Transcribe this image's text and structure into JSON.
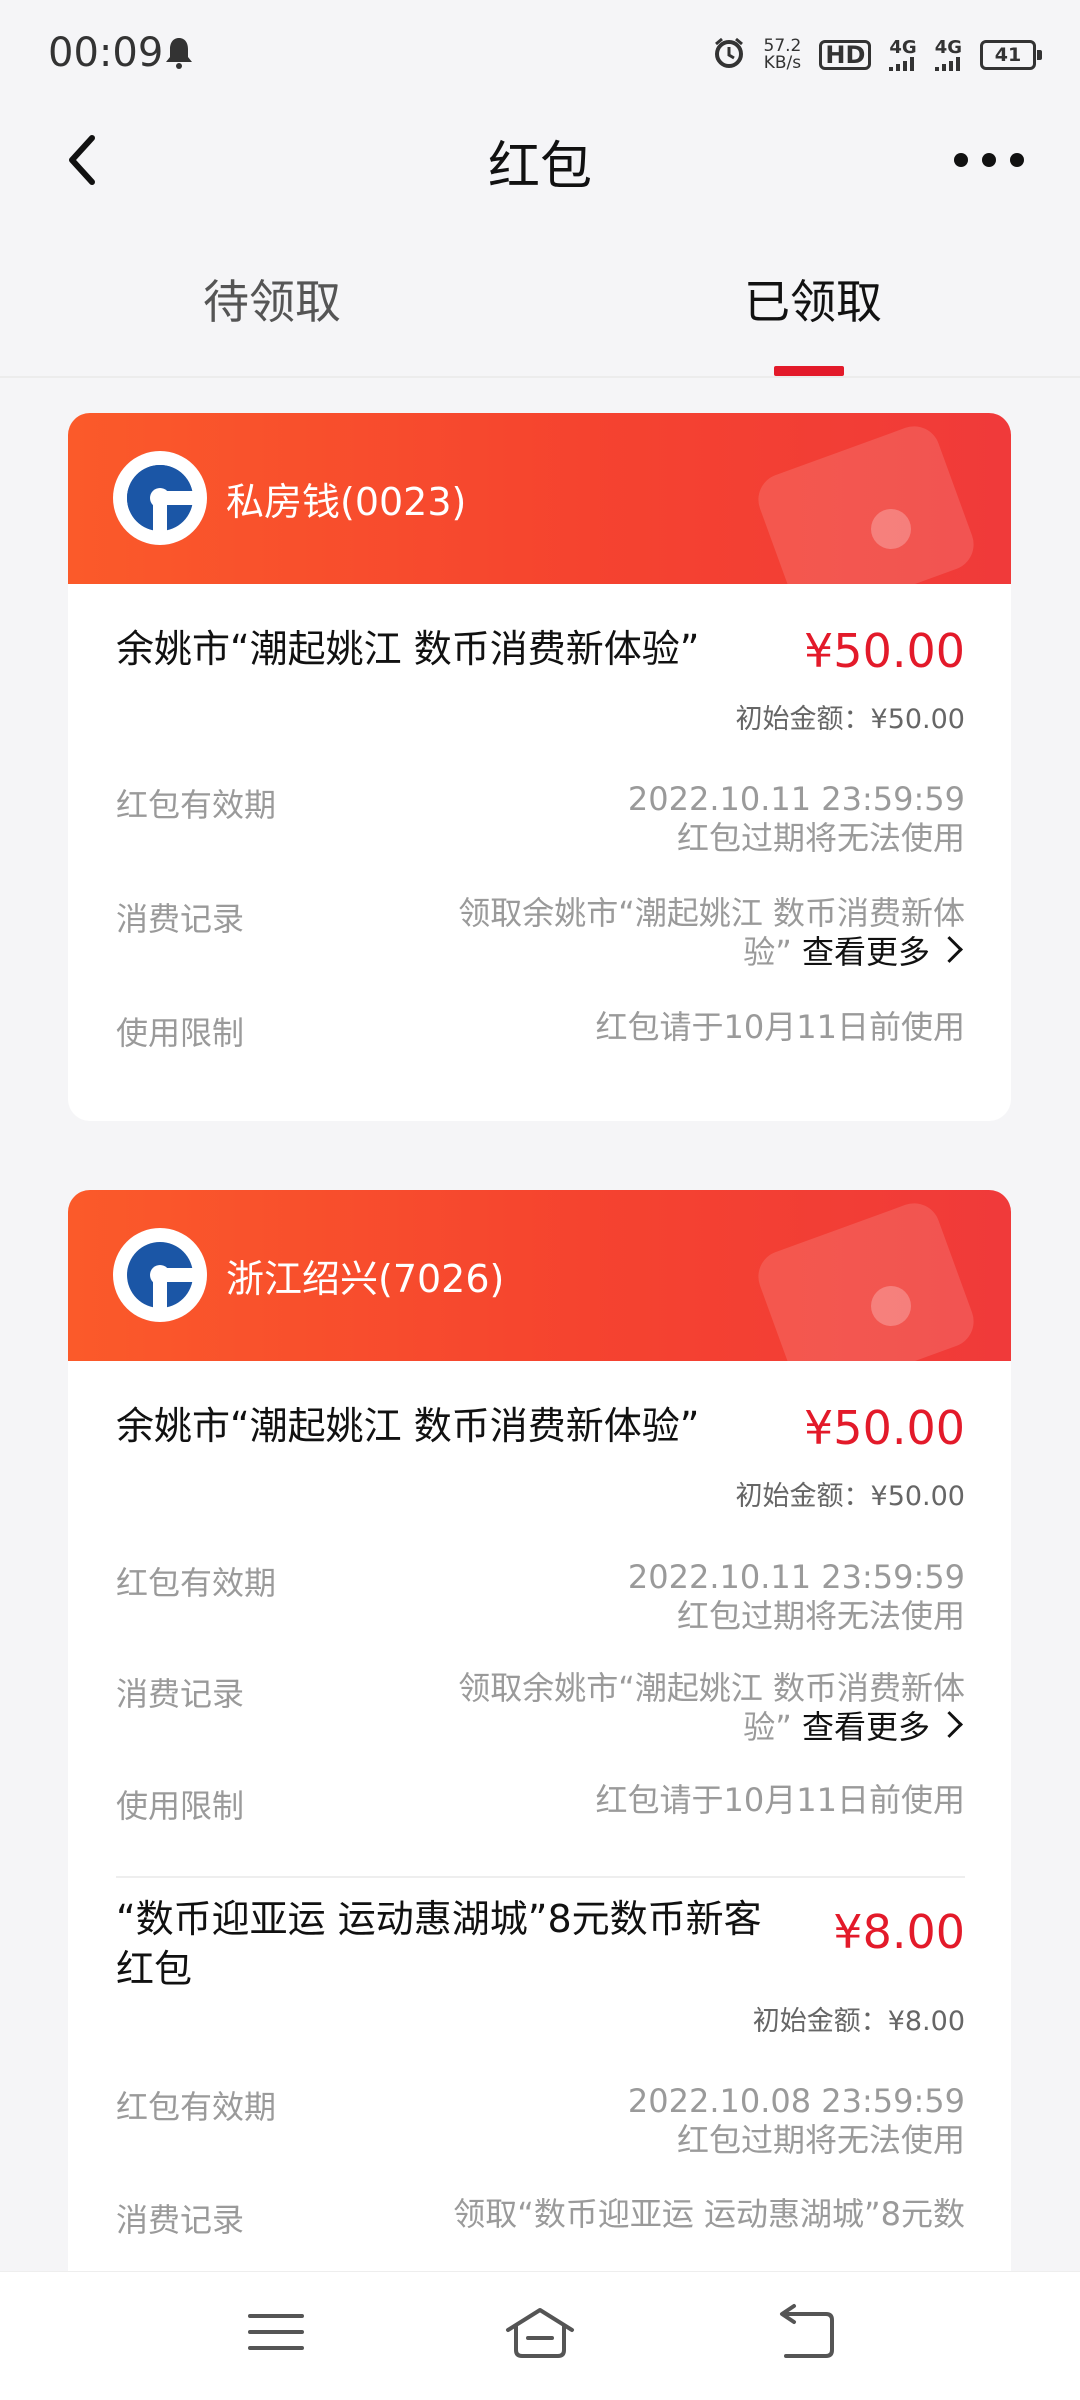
{
  "status_bar": {
    "time": "00:09",
    "net_speed_value": "57.2",
    "net_speed_unit": "KB/s",
    "hd": "HD",
    "sim1_type": "4G",
    "sim2_type": "4G",
    "battery": "41"
  },
  "header": {
    "title": "红包"
  },
  "tabs": [
    {
      "label": "待领取",
      "active": false
    },
    {
      "label": "已领取",
      "active": true
    }
  ],
  "colors": {
    "accent": "#e31a2a",
    "card_header": "#f5432f",
    "bank_blue": "#1b56a6"
  },
  "cards": [
    {
      "wallet_name": "私房钱(0023)",
      "items": [
        {
          "title": "余姚市“潮起姚江 数币消费新体验”",
          "amount": "¥50.00",
          "original_amount": "初始金额：¥50.00",
          "validity_label": "红包有效期",
          "validity_value": "2022.10.11 23:59:59",
          "validity_note": "红包过期将无法使用",
          "record_label": "消费记录",
          "record_value_line1": "领取余姚市“潮起姚江 数币消费新体",
          "record_value_line2": "验”",
          "view_more": "查看更多",
          "limit_label": "使用限制",
          "limit_value": "红包请于10月11日前使用"
        }
      ]
    },
    {
      "wallet_name": "浙江绍兴(7026)",
      "items": [
        {
          "title": "余姚市“潮起姚江 数币消费新体验”",
          "amount": "¥50.00",
          "original_amount": "初始金额：¥50.00",
          "validity_label": "红包有效期",
          "validity_value": "2022.10.11 23:59:59",
          "validity_note": "红包过期将无法使用",
          "record_label": "消费记录",
          "record_value_line1": "领取余姚市“潮起姚江 数币消费新体",
          "record_value_line2": "验”",
          "view_more": "查看更多",
          "limit_label": "使用限制",
          "limit_value": "红包请于10月11日前使用"
        },
        {
          "title_line1": "“数币迎亚运 运动惠湖城”8元数币新客",
          "title_line2": "红包",
          "amount": "¥8.00",
          "original_amount": "初始金额：¥8.00",
          "validity_label": "红包有效期",
          "validity_value": "2022.10.08 23:59:59",
          "validity_note": "红包过期将无法使用",
          "record_label": "消费记录",
          "record_value_line1": "领取“数币迎亚运 运动惠湖城”8元数"
        }
      ]
    }
  ],
  "bottom_nav": {
    "icons": [
      "menu-icon",
      "home-icon",
      "back-icon"
    ]
  }
}
